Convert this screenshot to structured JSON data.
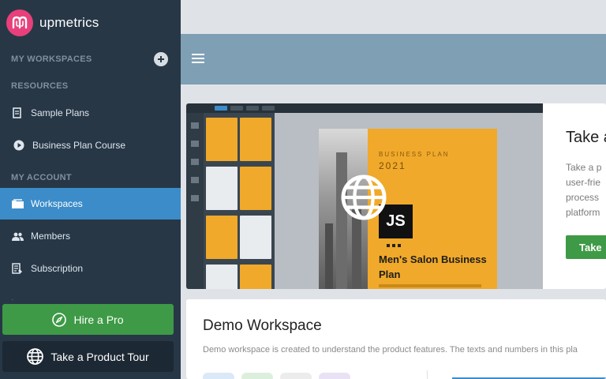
{
  "brand": {
    "name": "upmetrics"
  },
  "sidebar": {
    "workspaces_label": "MY WORKSPACES",
    "resources_label": "RESOURCES",
    "account_label": "MY ACCOUNT",
    "resources": [
      {
        "label": "Sample Plans",
        "icon": "document-icon"
      },
      {
        "label": "Business Plan Course",
        "icon": "play-circle-icon"
      }
    ],
    "account": [
      {
        "label": "Workspaces",
        "icon": "folder-icon",
        "active": true
      },
      {
        "label": "Members",
        "icon": "people-icon"
      },
      {
        "label": "Subscription",
        "icon": "receipt-icon"
      }
    ],
    "hire_pro": "Hire a Pro",
    "product_tour": "Take a Product Tour"
  },
  "promo": {
    "title": "Take a",
    "description": "Take a p\nuser-frie\nprocess \nplatform",
    "button": "Take",
    "video": {
      "kicker": "BUSINESS PLAN",
      "year": "2021",
      "title": "Men's Salon Business Plan"
    }
  },
  "workspace": {
    "title": "Demo Workspace",
    "description": "Demo workspace is created to understand the product features. The texts and numbers in this pla"
  },
  "colors": {
    "sidebar": "#273746",
    "active": "#3b8cc9",
    "green": "#3e9a46",
    "topbar": "#7f9fb5",
    "brand": "#e8407a",
    "doc": "#f0a92a"
  }
}
